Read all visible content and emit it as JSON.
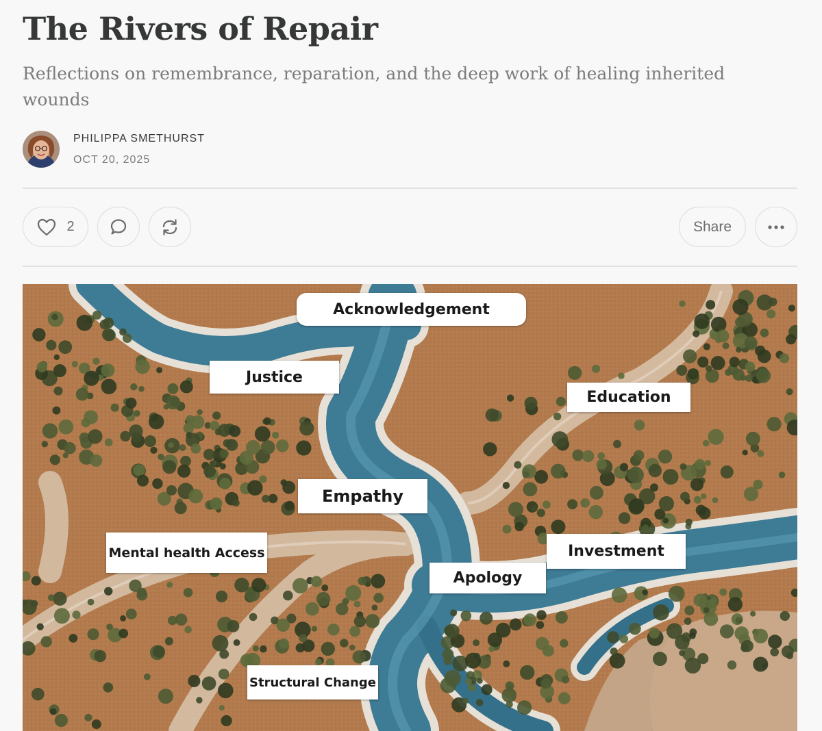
{
  "post": {
    "title": "The Rivers of Repair",
    "subtitle": "Reflections on remembrance, reparation, and the deep work of healing inherited wounds",
    "author": "PHILIPPA SMETHURST",
    "date": "OCT 20, 2025"
  },
  "actions": {
    "like_icon": "heart-icon",
    "like_count": "2",
    "comment_icon": "comment-icon",
    "restack_icon": "restack-icon",
    "share_label": "Share",
    "more_icon": "more-dots-icon"
  },
  "hero_image": {
    "labels": {
      "acknowledgement": "Acknowledgement",
      "justice": "Justice",
      "education": "Education",
      "empathy": "Empathy",
      "mental_health_access": "Mental health Access",
      "investment": "Investment",
      "apology": "Apology",
      "structural_change": "Structural Change"
    }
  },
  "colors": {
    "title": "#363737",
    "subtitle": "#7b7b7b",
    "divider": "#e2e2e2",
    "button_border": "#dcdcdc",
    "river": "#3e7b94",
    "terrain": "#b27a4d",
    "shrub": "#3e4a2a"
  }
}
